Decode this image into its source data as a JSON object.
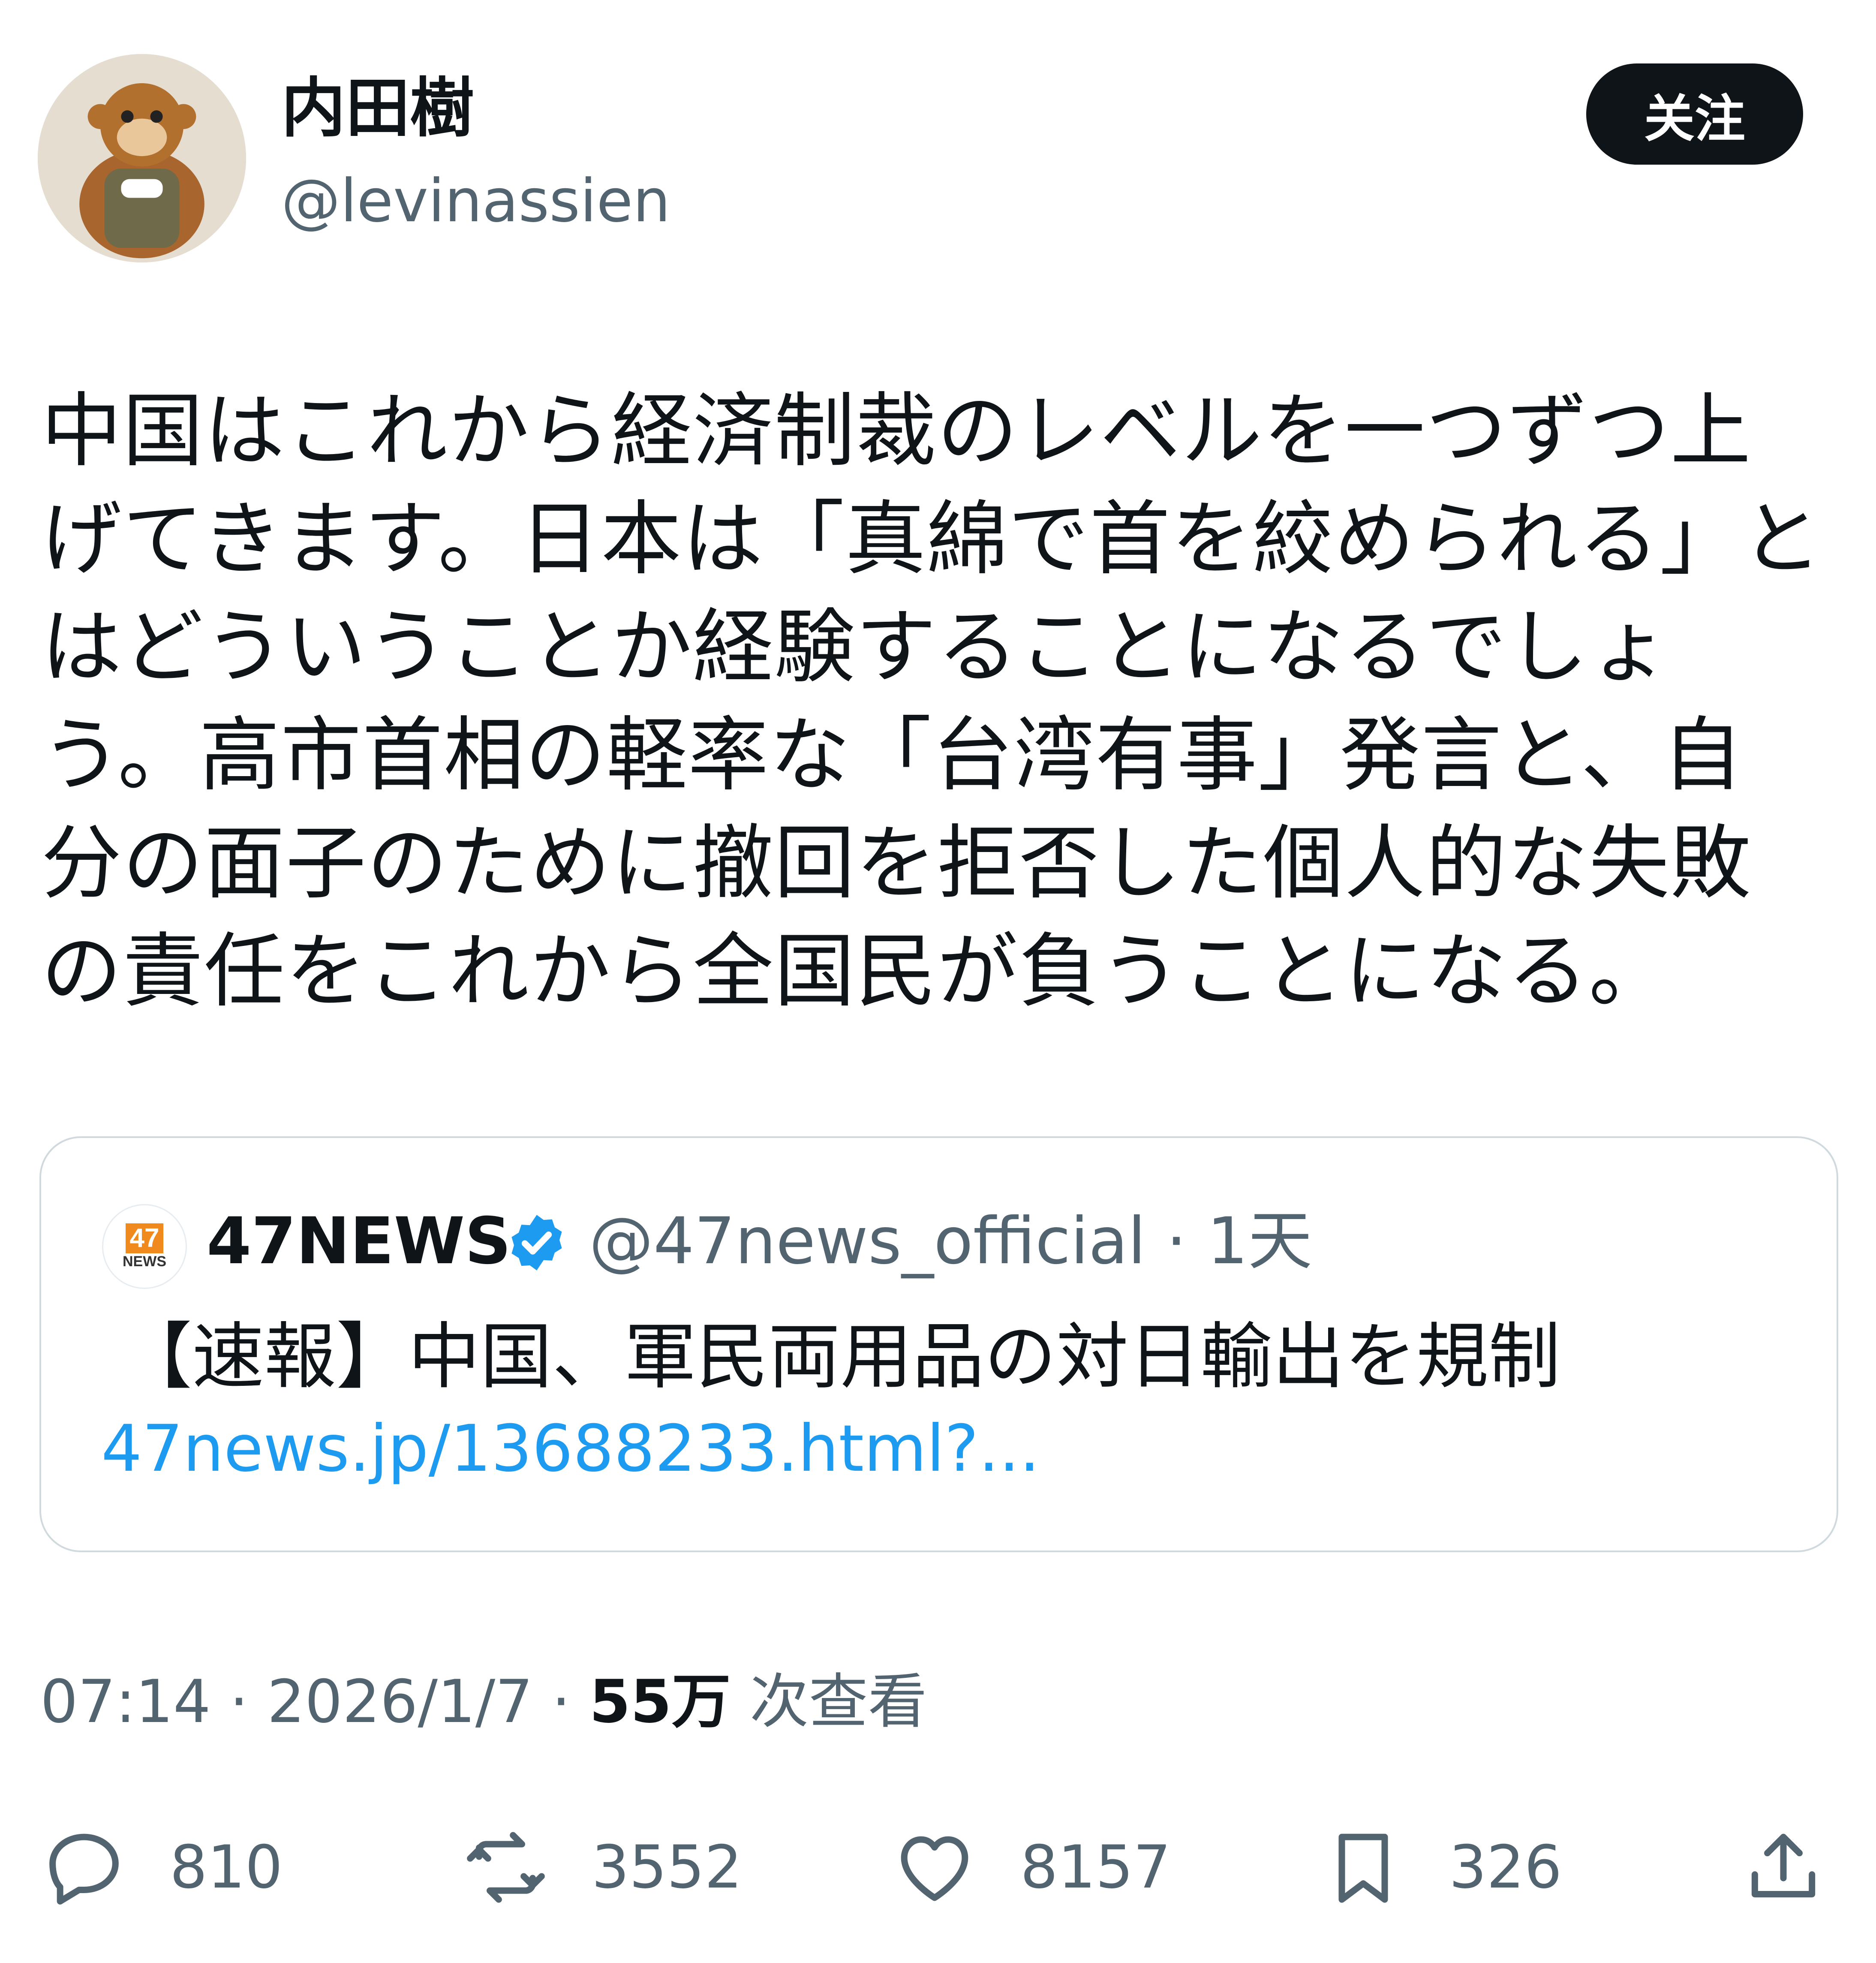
{
  "author": {
    "display_name": "内田樹",
    "handle": "@levinassien",
    "avatar_icon": "plush-monkey-avatar"
  },
  "follow_button": {
    "label": "关注"
  },
  "tweet": {
    "text": "中国はこれから経済制裁のレベルを一つずつ上げてきます。日本は「真綿で首を絞められる」とはどういうことか経験することになるでしょう。高市首相の軽率な「台湾有事」発言と、自分の面子のために撤回を拒否した個人的な失敗の責任をこれから全国民が負うことになる。"
  },
  "quote": {
    "avatar_number": "47",
    "avatar_label": "NEWS",
    "name": "47NEWS",
    "handle_time": "@47news_official · 1天",
    "text": "【速報】中国、軍民両用品の対日輸出を規制",
    "link": "47news.jp/13688233.html?..."
  },
  "meta": {
    "time_date": "07:14 · 2026/1/7 · ",
    "views_count": "55万",
    "views_label": " 次查看"
  },
  "actions": {
    "replies": "810",
    "reposts": "3552",
    "likes": "8157",
    "bookmarks": "326"
  },
  "colors": {
    "text": "#0f1419",
    "secondary": "#536471",
    "link": "#1d9bf0",
    "border": "#cfd9de",
    "accent_orange": "#f08a1c"
  }
}
